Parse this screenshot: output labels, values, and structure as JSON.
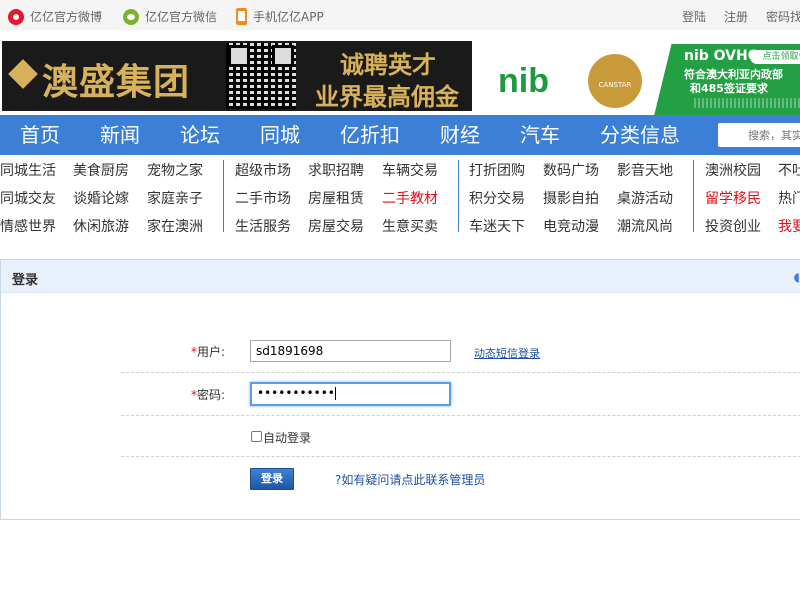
{
  "topbar": {
    "left": [
      {
        "icon": "weibo-icon",
        "label": "亿亿官方微博"
      },
      {
        "icon": "wechat-icon",
        "label": "亿亿官方微信"
      },
      {
        "icon": "phone-icon",
        "label": "手机亿亿APP"
      }
    ],
    "right": [
      "登陆",
      "注册",
      "密码找"
    ]
  },
  "banner_left": {
    "brand": "澳盛集团",
    "line1": "诚聘英才",
    "line2": "业界最高佣金"
  },
  "banner_right": {
    "logo": "nib",
    "canstar": "CANSTAR",
    "badge": "点击领取保",
    "title": "nib OVHC",
    "line1": "符合澳大利亚内政部",
    "line2": "和485签证要求"
  },
  "nav": {
    "items": [
      "首页",
      "新闻",
      "论坛",
      "同城",
      "亿折扣",
      "财经",
      "汽车",
      "分类信息"
    ],
    "search_placeholder": "搜索，其实"
  },
  "categories": {
    "row1": [
      "同城生活",
      "美食厨房",
      "宠物之家",
      "超级市场",
      "求职招聘",
      "车辆交易",
      "打折团购",
      "数码广场",
      "影音天地",
      "澳洲校园",
      "不吐"
    ],
    "row2": [
      "同城交友",
      "谈婚论嫁",
      "家庭亲子",
      "二手市场",
      "房屋租赁",
      "二手教材",
      "积分交易",
      "摄影自拍",
      "桌游活动",
      "留学移民",
      "热门"
    ],
    "row3": [
      "情感世界",
      "休闲旅游",
      "家在澳洲",
      "生活服务",
      "房屋交易",
      "生意买卖",
      "车迷天下",
      "电竞动漫",
      "潮流风尚",
      "投资创业",
      "我要"
    ],
    "highlight_color": "#e0101c"
  },
  "login": {
    "title": "登录",
    "username_label": "用户",
    "username_value": "sd1891698",
    "sms_login": "动态短信登录",
    "password_label": "密码",
    "password_value": "•••••••••••",
    "auto_login": "自动登录",
    "submit": "登录",
    "help": "?如有疑问请点此联系管理员",
    "accent": "#3b7fd6"
  }
}
